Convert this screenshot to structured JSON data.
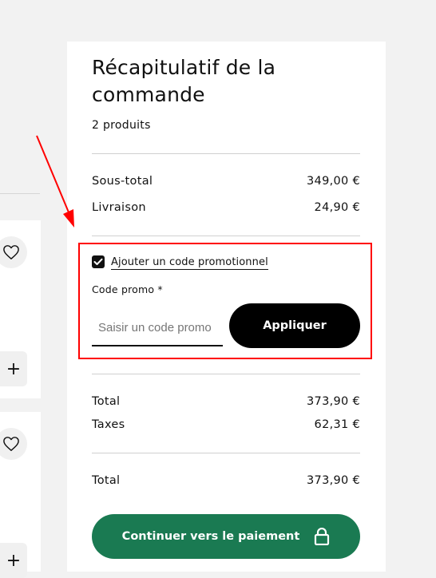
{
  "summary": {
    "title": "Récapitulatif de la commande",
    "product_count": "2 produits",
    "subtotal_label": "Sous-total",
    "subtotal_value": "349,00 €",
    "shipping_label": "Livraison",
    "shipping_value": "24,90 €"
  },
  "promo": {
    "checked": true,
    "toggle_label": "Ajouter un code promotionnel",
    "field_label": "Code promo *",
    "placeholder": "Saisir un code promo",
    "apply_label": "Appliquer"
  },
  "totals": {
    "total_label": "Total",
    "total_value": "373,90 €",
    "taxes_label": "Taxes",
    "taxes_value": "62,31 €",
    "grand_total_label": "Total",
    "grand_total_value": "373,90 €"
  },
  "checkout": {
    "pay_label": "Continuer vers le paiement",
    "pay_icon": "lock-icon",
    "pay_color": "#1a7a52"
  },
  "left_cards": {
    "add_glyph": "+"
  },
  "annotation": {
    "color": "#ff0000"
  }
}
